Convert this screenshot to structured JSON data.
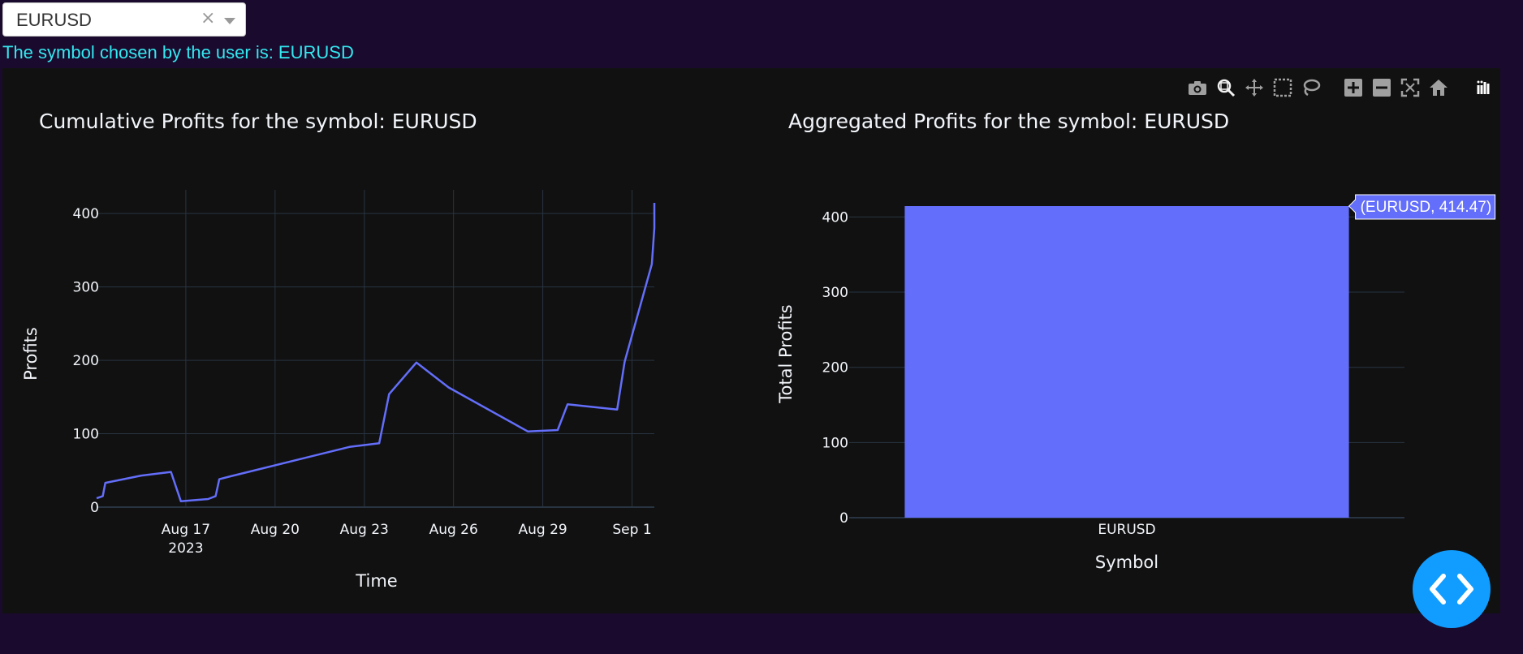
{
  "dropdown": {
    "value": "EURUSD",
    "clear_glyph": "×",
    "arrow_icon": "caret-down-icon"
  },
  "message": "The symbol chosen by the user is: EURUSD",
  "modebar": [
    "camera-icon",
    "zoom-icon",
    "pan-icon",
    "box-select-icon",
    "lasso-select-icon",
    "zoom-in-icon",
    "zoom-out-icon",
    "autoscale-icon",
    "reset-axes-icon",
    "plotly-logo-icon"
  ],
  "fab_icon": "code-icon",
  "colors": {
    "background": "#1a0b2e",
    "plot_bg": "#111111",
    "series": "#636efa",
    "grid": "#283442",
    "text": "#f2f5fa",
    "message": "#33e8f0",
    "fab": "#119dff"
  },
  "chart_data": [
    {
      "type": "line",
      "title": "Cumulative Profits for the symbol: EURUSD",
      "xlabel": "Time",
      "ylabel": "Profits",
      "x_ticks": [
        "Aug 17",
        "Aug 20",
        "Aug 23",
        "Aug 26",
        "Aug 29",
        "Sep 1"
      ],
      "x_tick_year": "2023",
      "y_ticks": [
        0,
        100,
        200,
        300,
        400
      ],
      "xlim": [
        "2023-08-14",
        "2023-09-01T18:00"
      ],
      "ylim": [
        0,
        430
      ],
      "grid": true,
      "series": [
        {
          "x": [
            "2023-08-14T00:00",
            "2023-08-14T05:00",
            "2023-08-14T07:00",
            "2023-08-15T12:00",
            "2023-08-16T12:00",
            "2023-08-16T20:00",
            "2023-08-17T18:00",
            "2023-08-18T00:00",
            "2023-08-18T03:00",
            "2023-08-18T12:00",
            "2023-08-19T00:00",
            "2023-08-22T12:00",
            "2023-08-23T12:00",
            "2023-08-23T20:00",
            "2023-08-24T18:00",
            "2023-08-25T20:00",
            "2023-08-28T12:00",
            "2023-08-29T12:00",
            "2023-08-29T20:00",
            "2023-08-31T12:00",
            "2023-08-31T18:00",
            "2023-09-01T16:00",
            "2023-09-01T18:00",
            "2023-09-01T18:00"
          ],
          "y": [
            12,
            15,
            33,
            43,
            48,
            8,
            11,
            15,
            38,
            42,
            47,
            82,
            87,
            154,
            197,
            163,
            103,
            105,
            140,
            133,
            198,
            331,
            380,
            414.47
          ]
        }
      ]
    },
    {
      "type": "bar",
      "title": "Aggregated Profits for the symbol: EURUSD",
      "xlabel": "Symbol",
      "ylabel": "Total Profits",
      "categories": [
        "EURUSD"
      ],
      "values": [
        414.47
      ],
      "y_ticks": [
        0,
        100,
        200,
        300,
        400
      ],
      "ylim": [
        0,
        414.47
      ],
      "grid": true,
      "hover_label": "(EURUSD, 414.47)"
    }
  ]
}
